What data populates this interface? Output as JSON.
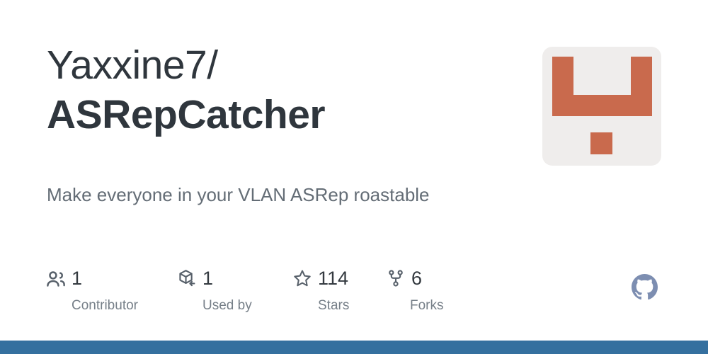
{
  "repo": {
    "owner": "Yaxxine7/",
    "name": "ASRepCatcher",
    "description": "Make everyone in your VLAN ASRep roastable"
  },
  "avatar": {
    "icon": "owner-avatar",
    "background_color": "#efedec",
    "mark_color": "#c96a4d",
    "alt": "Yaxxine7 avatar"
  },
  "stats": [
    {
      "icon": "people-icon",
      "count": "1",
      "label": "Contributor"
    },
    {
      "icon": "package-dependents-icon",
      "count": "1",
      "label": "Used by"
    },
    {
      "icon": "star-icon",
      "count": "114",
      "label": "Stars"
    },
    {
      "icon": "fork-icon",
      "count": "6",
      "label": "Forks"
    }
  ],
  "branding": {
    "icon": "github-mark-icon",
    "color": "#7d8eb1"
  },
  "language_bar": {
    "color": "#35709f"
  }
}
